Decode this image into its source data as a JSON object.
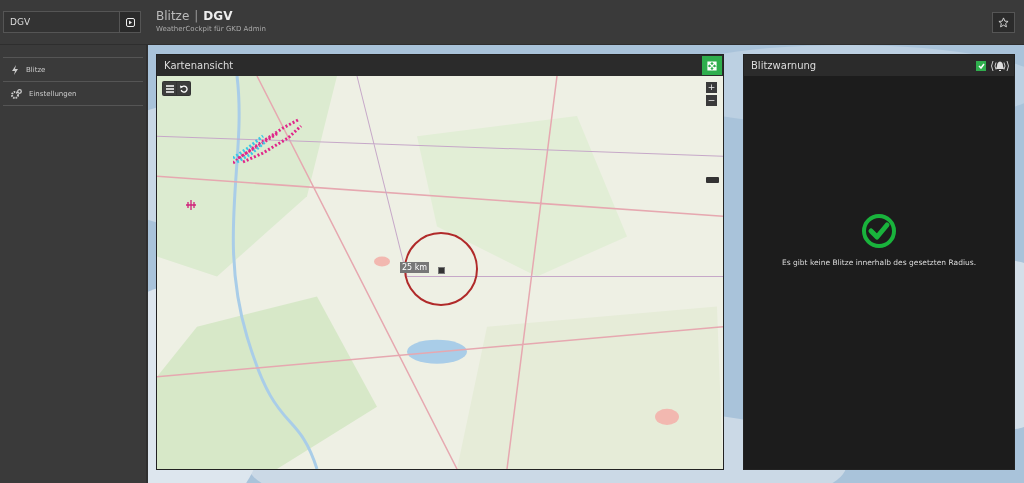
{
  "search": {
    "value": "DGV"
  },
  "header": {
    "title": "Blitze",
    "title_strong": "DGV",
    "separator": "|",
    "subtitle": "WeatherCockpit für GKD Admin"
  },
  "sidebar": {
    "items": [
      {
        "label": "Blitze",
        "kind": "bolt"
      },
      {
        "label": "Einstellungen",
        "kind": "gears"
      }
    ]
  },
  "map_panel": {
    "title": "Kartenansicht",
    "zoom_in": "+",
    "zoom_out": "−",
    "radius_label": "25 km"
  },
  "warning_panel": {
    "title": "Blitzwarnung",
    "alarm_enabled": true,
    "message": "Es gibt keine Blitze innerhalb des gesetzten Radius."
  }
}
